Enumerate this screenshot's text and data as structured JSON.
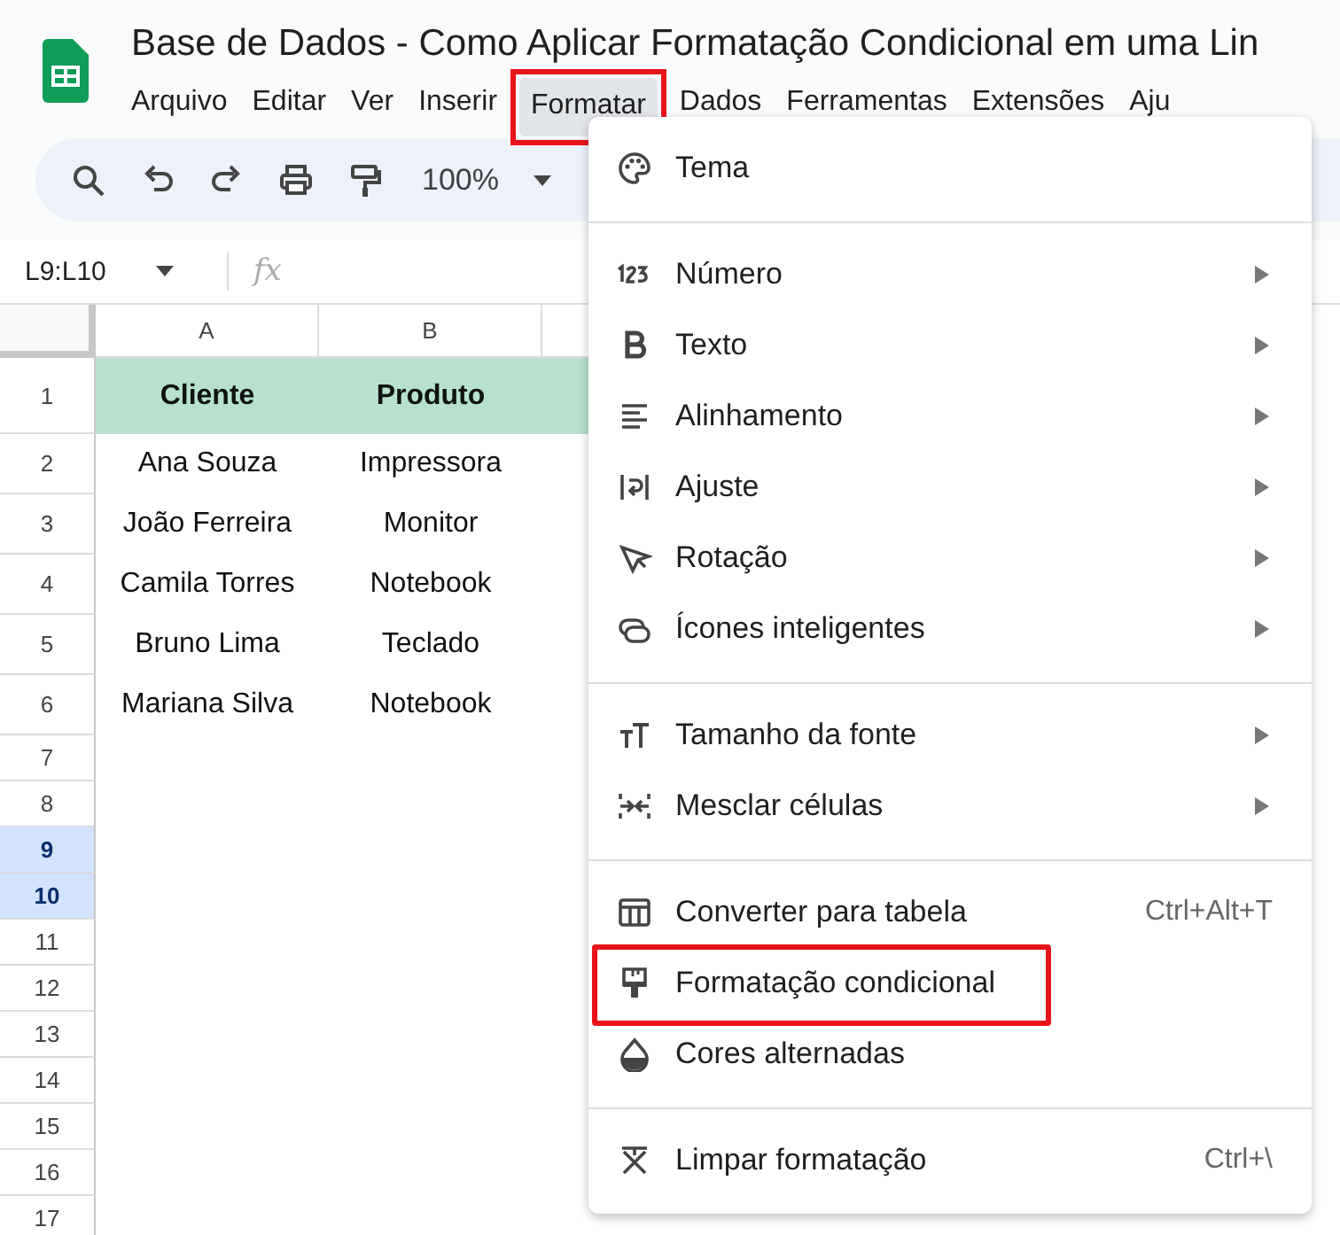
{
  "document": {
    "title": "Base de Dados - Como Aplicar Formatação Condicional em uma Lin"
  },
  "menubar": [
    {
      "label": "Arquivo",
      "selected": false,
      "annotated": false
    },
    {
      "label": "Editar",
      "selected": false,
      "annotated": false
    },
    {
      "label": "Ver",
      "selected": false,
      "annotated": false
    },
    {
      "label": "Inserir",
      "selected": false,
      "annotated": false
    },
    {
      "label": "Formatar",
      "selected": true,
      "annotated": true
    },
    {
      "label": "Dados",
      "selected": false,
      "annotated": false
    },
    {
      "label": "Ferramentas",
      "selected": false,
      "annotated": false
    },
    {
      "label": "Extensões",
      "selected": false,
      "annotated": false
    },
    {
      "label": "Aju",
      "selected": false,
      "annotated": false
    }
  ],
  "toolbar": {
    "zoom": "100%"
  },
  "formula_bar": {
    "name_box": "L9:L10",
    "fx": "fx"
  },
  "sheet": {
    "columns": [
      "A",
      "B"
    ],
    "rows": [
      {
        "number": "1",
        "selected": false,
        "kind": "header",
        "cells": [
          "Cliente",
          "Produto"
        ]
      },
      {
        "number": "2",
        "selected": false,
        "kind": "data",
        "cells": [
          "Ana Souza",
          "Impressora"
        ]
      },
      {
        "number": "3",
        "selected": false,
        "kind": "data",
        "cells": [
          "João Ferreira",
          "Monitor"
        ]
      },
      {
        "number": "4",
        "selected": false,
        "kind": "data",
        "cells": [
          "Camila Torres",
          "Notebook"
        ]
      },
      {
        "number": "5",
        "selected": false,
        "kind": "data",
        "cells": [
          "Bruno Lima",
          "Teclado"
        ]
      },
      {
        "number": "6",
        "selected": false,
        "kind": "data",
        "cells": [
          "Mariana Silva",
          "Notebook"
        ]
      },
      {
        "number": "7",
        "selected": false,
        "kind": "empty",
        "cells": []
      },
      {
        "number": "8",
        "selected": false,
        "kind": "empty",
        "cells": []
      },
      {
        "number": "9",
        "selected": true,
        "kind": "empty",
        "cells": []
      },
      {
        "number": "10",
        "selected": true,
        "kind": "empty",
        "cells": []
      },
      {
        "number": "11",
        "selected": false,
        "kind": "empty",
        "cells": []
      },
      {
        "number": "12",
        "selected": false,
        "kind": "empty",
        "cells": []
      },
      {
        "number": "13",
        "selected": false,
        "kind": "empty",
        "cells": []
      },
      {
        "number": "14",
        "selected": false,
        "kind": "empty",
        "cells": []
      },
      {
        "number": "15",
        "selected": false,
        "kind": "empty",
        "cells": []
      },
      {
        "number": "16",
        "selected": false,
        "kind": "empty",
        "cells": []
      },
      {
        "number": "17",
        "selected": false,
        "kind": "empty",
        "cells": []
      }
    ]
  },
  "format_menu": {
    "sections": [
      {
        "items": [
          {
            "label": "Tema",
            "submenu": false,
            "annotated": false
          }
        ]
      },
      {
        "items": [
          {
            "label": "Número",
            "submenu": true,
            "annotated": false
          },
          {
            "label": "Texto",
            "submenu": true,
            "annotated": false
          },
          {
            "label": "Alinhamento",
            "submenu": true,
            "annotated": false
          },
          {
            "label": "Ajuste",
            "submenu": true,
            "annotated": false
          },
          {
            "label": "Rotação",
            "submenu": true,
            "annotated": false
          },
          {
            "label": "Ícones inteligentes",
            "submenu": true,
            "annotated": false
          }
        ]
      },
      {
        "items": [
          {
            "label": "Tamanho da fonte",
            "submenu": true,
            "annotated": false
          },
          {
            "label": "Mesclar células",
            "submenu": true,
            "annotated": false
          }
        ]
      },
      {
        "items": [
          {
            "label": "Converter para tabela",
            "submenu": false,
            "shortcut": "Ctrl+Alt+T",
            "annotated": false
          },
          {
            "label": "Formatação condicional",
            "submenu": false,
            "annotated": true
          },
          {
            "label": "Cores alternadas",
            "submenu": false,
            "annotated": false
          }
        ]
      },
      {
        "items": [
          {
            "label": "Limpar formatação",
            "submenu": false,
            "shortcut": "Ctrl+\\",
            "annotated": false
          }
        ]
      }
    ]
  }
}
